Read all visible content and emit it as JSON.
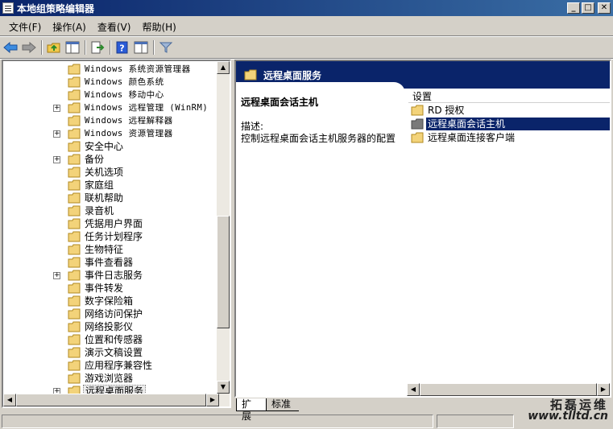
{
  "window": {
    "title": "本地组策略编辑器"
  },
  "menu": [
    "文件(F)",
    "操作(A)",
    "查看(V)",
    "帮助(H)"
  ],
  "toolbar": [
    "back-icon",
    "forward-icon",
    "up-folder-icon",
    "show-hide-tree-icon",
    "export-list-icon",
    "help-icon",
    "properties-icon",
    "filter-icon"
  ],
  "tree": {
    "items": [
      {
        "label": "Windows 系统资源管理器",
        "expandable": false
      },
      {
        "label": "Windows 颜色系统",
        "expandable": false
      },
      {
        "label": "Windows 移动中心",
        "expandable": false
      },
      {
        "label": "Windows 远程管理 (WinRM)",
        "expandable": true
      },
      {
        "label": "Windows 远程解释器",
        "expandable": false
      },
      {
        "label": "Windows 资源管理器",
        "expandable": true
      },
      {
        "label": "安全中心",
        "expandable": false
      },
      {
        "label": "备份",
        "expandable": true
      },
      {
        "label": "关机选项",
        "expandable": false
      },
      {
        "label": "家庭组",
        "expandable": false
      },
      {
        "label": "联机帮助",
        "expandable": false
      },
      {
        "label": "录音机",
        "expandable": false
      },
      {
        "label": "凭据用户界面",
        "expandable": false
      },
      {
        "label": "任务计划程序",
        "expandable": false
      },
      {
        "label": "生物特征",
        "expandable": false
      },
      {
        "label": "事件查看器",
        "expandable": false
      },
      {
        "label": "事件日志服务",
        "expandable": true
      },
      {
        "label": "事件转发",
        "expandable": false
      },
      {
        "label": "数字保险箱",
        "expandable": false
      },
      {
        "label": "网络访问保护",
        "expandable": false
      },
      {
        "label": "网络投影仪",
        "expandable": false
      },
      {
        "label": "位置和传感器",
        "expandable": false
      },
      {
        "label": "演示文稿设置",
        "expandable": false
      },
      {
        "label": "应用程序兼容性",
        "expandable": false
      },
      {
        "label": "游戏浏览器",
        "expandable": false
      },
      {
        "label": "远程桌面服务",
        "expandable": true,
        "selected": true
      }
    ]
  },
  "right": {
    "header": "远程桌面服务",
    "detail_title": "远程桌面会话主机",
    "desc_label": "描述:",
    "desc_text": "控制远程桌面会话主机服务器的配置",
    "column_header": "设置",
    "items": [
      {
        "label": "RD 授权",
        "selected": false
      },
      {
        "label": "远程桌面会话主机",
        "selected": true
      },
      {
        "label": "远程桌面连接客户端",
        "selected": false
      }
    ]
  },
  "tabs": [
    "扩展",
    "标准"
  ],
  "watermark": {
    "line1": "拓磊运维",
    "line2": "www.tlltd.cn"
  }
}
